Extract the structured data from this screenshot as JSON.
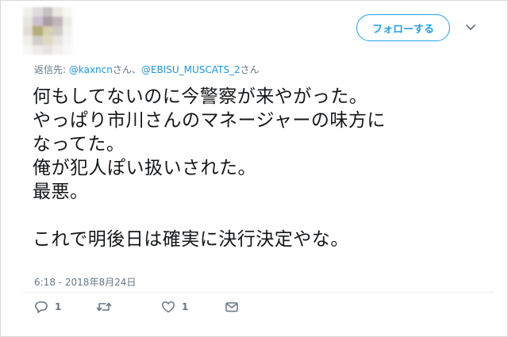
{
  "header": {
    "avatar_colors": [
      "#f0eee9",
      "#d8d6d8",
      "#bcb7b6",
      "#e8e4df",
      "#f7f6f3",
      "#e5e2dc",
      "#c4b6c6",
      "#9c8c93",
      "#b6aab0",
      "#ece9e4",
      "#dcd8cf",
      "#a99f5e",
      "#d0c8a4",
      "#c7c2bd",
      "#f2f0ec",
      "#eeece7",
      "#c9c5bf",
      "#d9d3b9",
      "#e4e0da",
      "#f5f4f1",
      "#f6f5f2",
      "#ebe8e3",
      "#e3e0db",
      "#f0eeea",
      "#f8f7f5"
    ],
    "follow_label": "フォローする"
  },
  "reply": {
    "prefix": "返信先: ",
    "mention1": "@kaxncn",
    "sep": "さん、",
    "mention2": "@EBISU_MUSCATS_2",
    "suffix": "さん"
  },
  "tweet": {
    "lines": [
      "何もしてないのに今警察が来やがった。",
      "やっぱり市川さんのマネージャーの味方に",
      "なってた。",
      "俺が犯人ぽい扱いされた。",
      "最悪。",
      "",
      "これで明後日は確実に決行決定やな。"
    ],
    "timestamp": "6:18 - 2018年8月24日"
  },
  "actions": {
    "reply_count": "1",
    "retweet_count": "",
    "like_count": "1"
  },
  "colors": {
    "accent": "#1da1f2",
    "muted": "#657786",
    "text": "#14171a"
  }
}
